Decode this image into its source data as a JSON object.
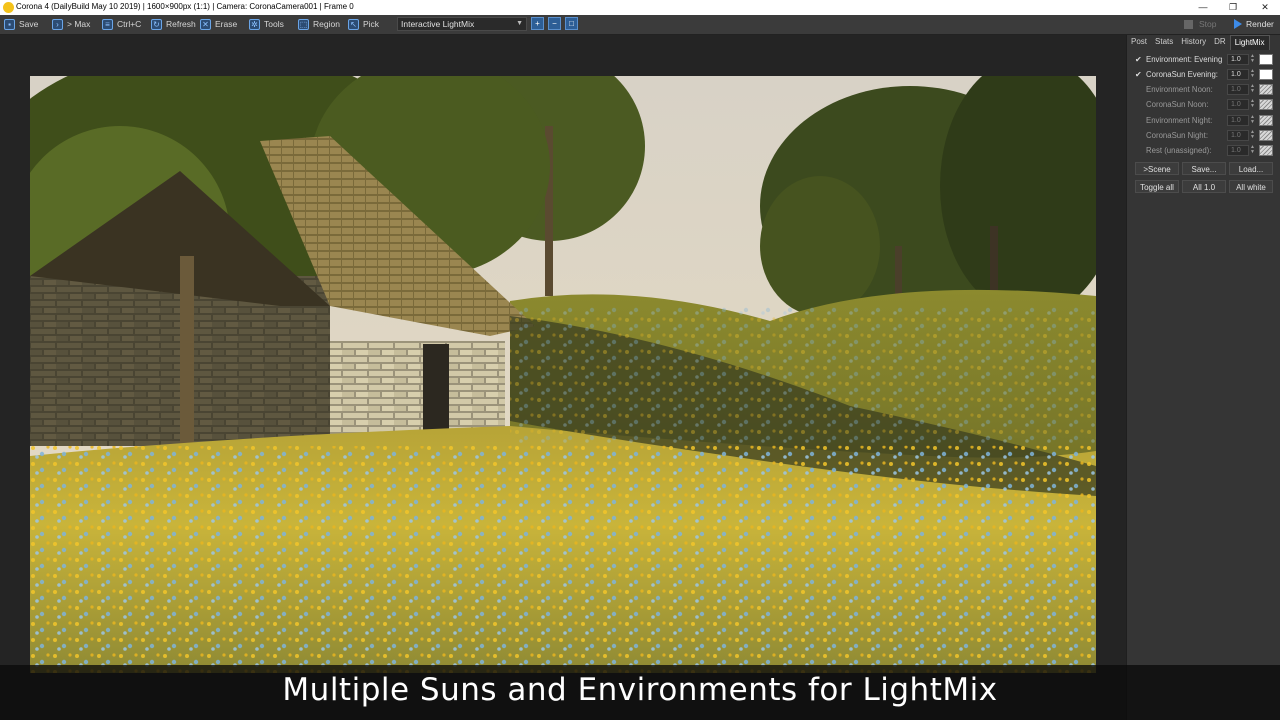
{
  "window": {
    "title": "Corona 4 (DailyBuild May 10 2019) | 1600×900px (1:1) | Camera: CoronaCamera001 | Frame 0",
    "minimize": "—",
    "restore": "❐",
    "close": "✕"
  },
  "toolbar": {
    "save": "Save",
    "max": "> Max",
    "copy": "Ctrl+C",
    "refresh": "Refresh",
    "erase": "Erase",
    "tools": "Tools",
    "region": "Region",
    "pick": "Pick",
    "channel_selected": "Interactive LightMix",
    "stop": "Stop",
    "render": "Render"
  },
  "panel": {
    "tabs": [
      "Post",
      "Stats",
      "History",
      "DR",
      "LightMix"
    ],
    "active_tab": "LightMix",
    "lightmix_rows": [
      {
        "name": "Environment: Evening",
        "value": "1.0",
        "checked": true
      },
      {
        "name": "CoronaSun Evening:",
        "value": "1.0",
        "checked": true
      },
      {
        "name": "Environment Noon:",
        "value": "1.0",
        "checked": false
      },
      {
        "name": "CoronaSun Noon:",
        "value": "1.0",
        "checked": false
      },
      {
        "name": "Environment Night:",
        "value": "1.0",
        "checked": false
      },
      {
        "name": "CoronaSun Night:",
        "value": "1.0",
        "checked": false
      },
      {
        "name": "Rest (unassigned):",
        "value": "1.0",
        "checked": false
      }
    ],
    "buttons_row1": [
      ">Scene",
      "Save...",
      "Load..."
    ],
    "buttons_row2": [
      "Toggle all",
      "All 1.0",
      "All white"
    ]
  },
  "caption": "Multiple Suns and Environments for LightMix",
  "colors": {
    "accent": "#3d8be8",
    "panel_bg": "#353535",
    "toolbar_bg": "#3b3b3b"
  }
}
